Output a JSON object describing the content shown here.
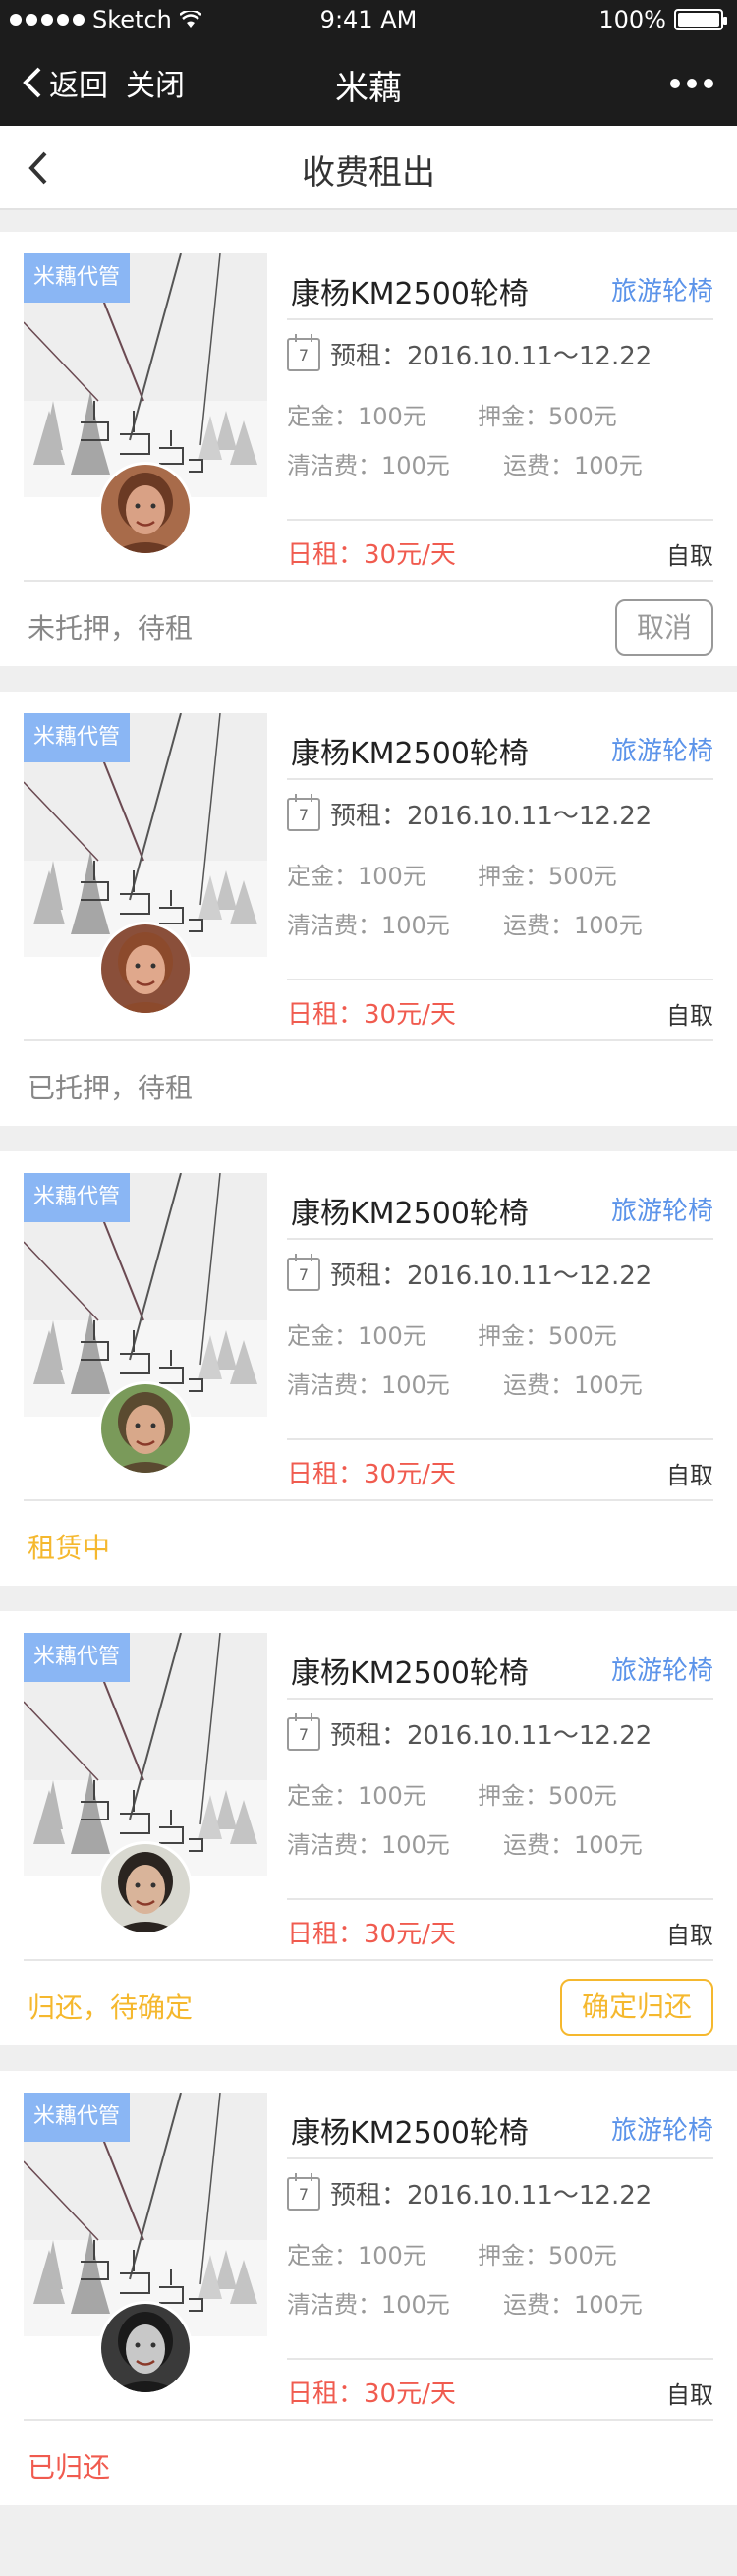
{
  "status_bar": {
    "carrier": "Sketch",
    "time": "9:41 AM",
    "battery": "100%",
    "battery_level": 1.0
  },
  "wechat_bar": {
    "back": "返回",
    "close": "关闭",
    "title": "米藕"
  },
  "nav": {
    "title": "收费租出"
  },
  "colors": {
    "accent_blue": "#5b93e9",
    "price_red": "#f05b4f",
    "status_yellow": "#f5b82e",
    "tag_blue": "#8ab6f4"
  },
  "orders": [
    {
      "tag": "米藕代管",
      "product": "康杨KM2500轮椅",
      "category": "旅游轮椅",
      "date": "预租：2016.10.11～12.22",
      "calendar_day": "7",
      "deposit": "定金：100元",
      "security": "押金：500元",
      "cleaning": "清洁费：100元",
      "shipping": "运费：100元",
      "rent": "日租：30元/天",
      "pickup": "自取",
      "status": "未托押，待租",
      "status_color": "#888888",
      "action": "取消",
      "action_color": "#999999",
      "avatar_bg": "#a86b4a",
      "avatar_face": "#d9a185",
      "avatar_hair": "#6b3a24"
    },
    {
      "tag": "米藕代管",
      "product": "康杨KM2500轮椅",
      "category": "旅游轮椅",
      "date": "预租：2016.10.11～12.22",
      "calendar_day": "7",
      "deposit": "定金：100元",
      "security": "押金：500元",
      "cleaning": "清洁费：100元",
      "shipping": "运费：100元",
      "rent": "日租：30元/天",
      "pickup": "自取",
      "status": "已托押，待租",
      "status_color": "#888888",
      "action": "",
      "action_color": "",
      "avatar_bg": "#8a4f3a",
      "avatar_face": "#e0a88c",
      "avatar_hair": "#8c4a2c"
    },
    {
      "tag": "米藕代管",
      "product": "康杨KM2500轮椅",
      "category": "旅游轮椅",
      "date": "预租：2016.10.11～12.22",
      "calendar_day": "7",
      "deposit": "定金：100元",
      "security": "押金：500元",
      "cleaning": "清洁费：100元",
      "shipping": "运费：100元",
      "rent": "日租：30元/天",
      "pickup": "自取",
      "status": "租赁中",
      "status_color": "#f5b82e",
      "action": "",
      "action_color": "",
      "avatar_bg": "#7a9a5a",
      "avatar_face": "#d8a88a",
      "avatar_hair": "#5a4a30"
    },
    {
      "tag": "米藕代管",
      "product": "康杨KM2500轮椅",
      "category": "旅游轮椅",
      "date": "预租：2016.10.11～12.22",
      "calendar_day": "7",
      "deposit": "定金：100元",
      "security": "押金：500元",
      "cleaning": "清洁费：100元",
      "shipping": "运费：100元",
      "rent": "日租：30元/天",
      "pickup": "自取",
      "status": "归还，待确定",
      "status_color": "#f5b82e",
      "action": "确定归还",
      "action_color": "#f5b82e",
      "avatar_bg": "#d8d8d0",
      "avatar_face": "#d9b49a",
      "avatar_hair": "#2a2420"
    },
    {
      "tag": "米藕代管",
      "product": "康杨KM2500轮椅",
      "category": "旅游轮椅",
      "date": "预租：2016.10.11～12.22",
      "calendar_day": "7",
      "deposit": "定金：100元",
      "security": "押金：500元",
      "cleaning": "清洁费：100元",
      "shipping": "运费：100元",
      "rent": "日租：30元/天",
      "pickup": "自取",
      "status": "已归还",
      "status_color": "#f05b4f",
      "action": "",
      "action_color": "",
      "avatar_bg": "#3a3a3a",
      "avatar_face": "#c8c8c8",
      "avatar_hair": "#1a1a1a"
    }
  ]
}
